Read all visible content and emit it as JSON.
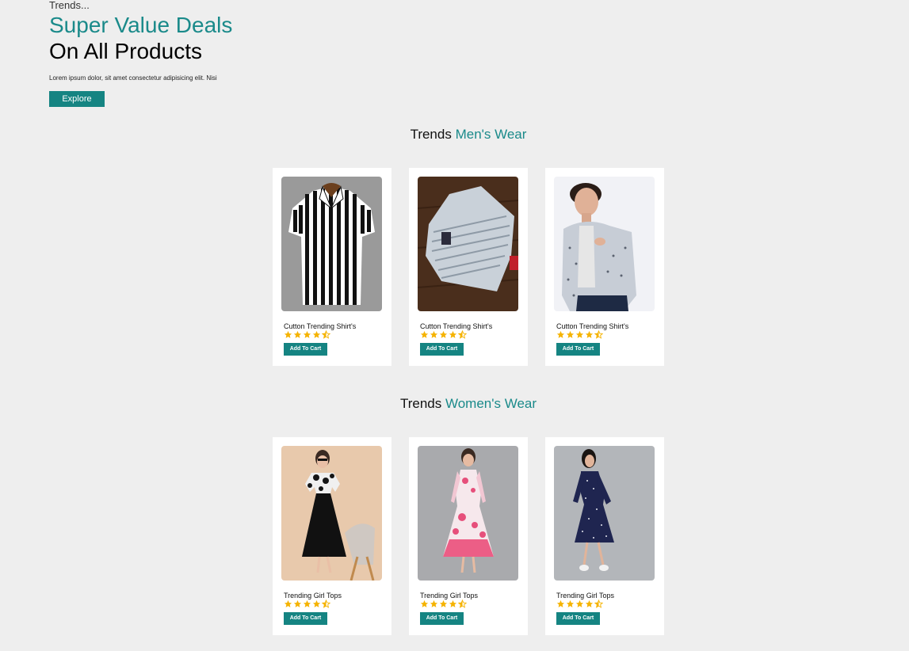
{
  "hero": {
    "eyebrow": "Trends...",
    "title_line1": "Super Value Deals",
    "title_line2": "On All Products",
    "text": "Lorem ipsum dolor, sit amet consectetur adipisicing elit. Nisi",
    "button_label": "Explore"
  },
  "mens": {
    "title_prefix": "Trends",
    "title_accent": "Men's Wear",
    "products": [
      {
        "name": "Cutton Trending Shirt's",
        "rating": 4.5,
        "button": "Add To Cart",
        "image": "striped-shirt"
      },
      {
        "name": "Cutton Trending Shirt's",
        "rating": 4.5,
        "button": "Add To Cart",
        "image": "folded-shirt"
      },
      {
        "name": "Cutton Trending Shirt's",
        "rating": 4.5,
        "button": "Add To Cart",
        "image": "model-shirt"
      }
    ]
  },
  "womens": {
    "title_prefix": "Trends",
    "title_accent": "Women's Wear",
    "products": [
      {
        "name": "Trending Girl Tops",
        "rating": 4.5,
        "button": "Add To Cart",
        "image": "black-dress"
      },
      {
        "name": "Trending Girl Tops",
        "rating": 4.5,
        "button": "Add To Cart",
        "image": "pink-floral-dress"
      },
      {
        "name": "Trending Girl Tops",
        "rating": 4.5,
        "button": "Add To Cart",
        "image": "navy-polka-dress"
      }
    ]
  },
  "colors": {
    "accent": "#1a8a8a",
    "button": "#158482",
    "star": "#f5b301",
    "background": "#eeeeee"
  }
}
